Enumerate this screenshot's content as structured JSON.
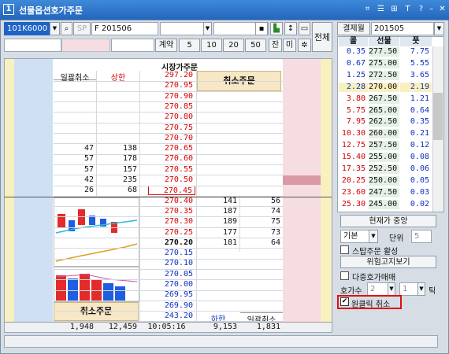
{
  "window": {
    "title": "선물옵션호가주문",
    "icon_label": "1"
  },
  "toolbar": {
    "code": "101K6000",
    "code_label": "F 201506",
    "btn_all": "전체",
    "contract_label": "계약",
    "qty_buttons": [
      "5",
      "10",
      "20",
      "50"
    ],
    "btn_jan": "잔",
    "btn_mi": "미"
  },
  "orderbook": {
    "market_order": "시장가주문",
    "cancel_order": "취소주문",
    "cancel_all": "일괄취소",
    "upper_limit": "상한",
    "lower_limit": "하한",
    "cancel_all_bottom": "일괄취소",
    "cancel_order_bottom": "취소주문",
    "prices": [
      "297.20",
      "270.95",
      "270.90",
      "270.85",
      "270.80",
      "270.75",
      "270.70",
      "270.65",
      "270.60",
      "270.55",
      "270.50",
      "270.45",
      "270.40",
      "270.35",
      "270.30",
      "270.25",
      "270.20",
      "270.15",
      "270.10",
      "270.05",
      "270.00",
      "269.95",
      "269.90",
      "243.20"
    ],
    "ask_rows": [
      {
        "price": "270.65",
        "qty": "47",
        "cnt": "138"
      },
      {
        "price": "270.60",
        "qty": "57",
        "cnt": "178"
      },
      {
        "price": "270.55",
        "qty": "57",
        "cnt": "157"
      },
      {
        "price": "270.50",
        "qty": "42",
        "cnt": "235"
      },
      {
        "price": "270.45",
        "qty": "26",
        "cnt": "68"
      }
    ],
    "bid_rows": [
      {
        "price": "270.40",
        "qty": "141",
        "cnt": "56"
      },
      {
        "price": "270.35",
        "qty": "187",
        "cnt": "74"
      },
      {
        "price": "270.30",
        "qty": "189",
        "cnt": "75"
      },
      {
        "price": "270.25",
        "qty": "177",
        "cnt": "73"
      },
      {
        "price": "270.20",
        "qty": "181",
        "cnt": "64"
      }
    ],
    "footer": {
      "ask_qty": "1,948",
      "ask_cnt": "12,459",
      "time": "10:05:16",
      "bid_qty": "9,153",
      "bid_cnt": "1,831"
    }
  },
  "right_panel": {
    "expiry_label": "결제월",
    "expiry_value": "201505",
    "headers": [
      "콜",
      "선물",
      "풋"
    ],
    "rows": [
      {
        "call": "0.35",
        "fut": "277.50",
        "put": "7.75"
      },
      {
        "call": "0.67",
        "fut": "275.00",
        "put": "5.55"
      },
      {
        "call": "1.25",
        "fut": "272.50",
        "put": "3.65"
      },
      {
        "call": "2.28",
        "fut": "270.00",
        "put": "2.19"
      },
      {
        "call": "3.80",
        "fut": "267.50",
        "put": "1.21"
      },
      {
        "call": "5.75",
        "fut": "265.00",
        "put": "0.64"
      },
      {
        "call": "7.95",
        "fut": "262.50",
        "put": "0.35"
      },
      {
        "call": "10.30",
        "fut": "260.00",
        "put": "0.21"
      },
      {
        "call": "12.75",
        "fut": "257.50",
        "put": "0.12"
      },
      {
        "call": "15.40",
        "fut": "255.00",
        "put": "0.08"
      },
      {
        "call": "17.35",
        "fut": "252.50",
        "put": "0.06"
      },
      {
        "call": "20.25",
        "fut": "250.00",
        "put": "0.05"
      },
      {
        "call": "23.60",
        "fut": "247.50",
        "put": "0.03"
      },
      {
        "call": "25.30",
        "fut": "245.00",
        "put": "0.02"
      }
    ],
    "btn_center": "현재가 중앙",
    "basic": "기본",
    "unit_label": "단위",
    "unit_value": "5",
    "stop_order": "스탑주문 활성",
    "risk_notice": "위험고지보기",
    "multi_trade": "다중호가매매",
    "hoga_count_label": "호가수",
    "hoga_count": "2",
    "tick_value": "1",
    "tick_label": "틱",
    "oneclick": "원클릭 취소"
  },
  "colors": {
    "accent": "#2f78d2",
    "pink": "#f6dde2",
    "blue_col": "#cfe0f5",
    "yellow": "#f9f0c0"
  }
}
